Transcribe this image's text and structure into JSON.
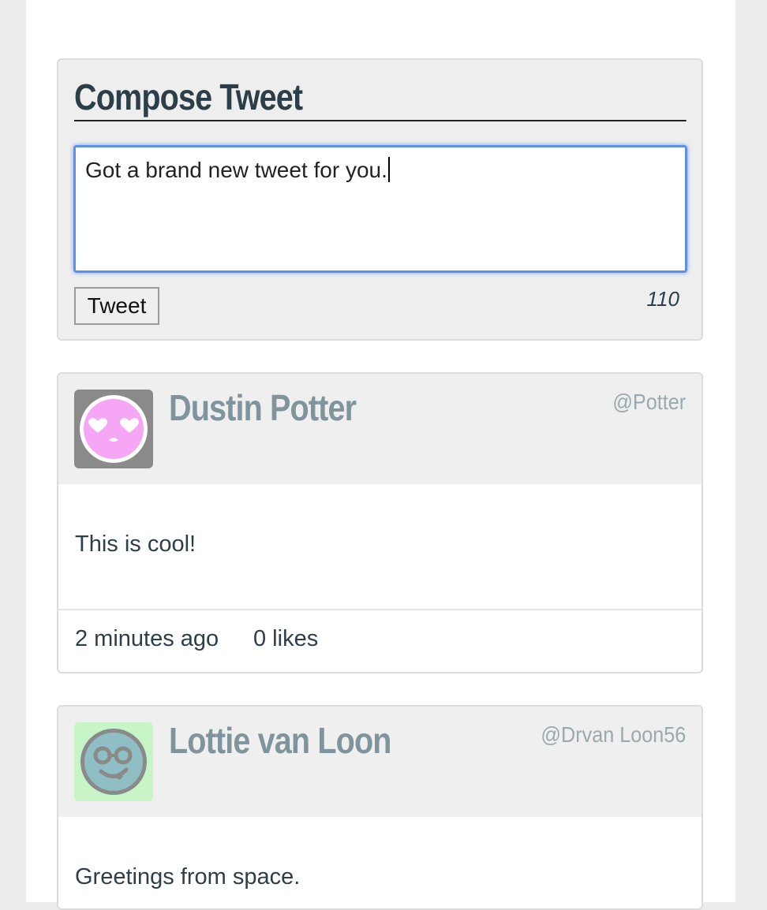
{
  "compose": {
    "title": "Compose Tweet",
    "textarea_value": "Got a brand new tweet for you.",
    "button_label": "Tweet",
    "counter": "110"
  },
  "tweets": [
    {
      "name": "Dustin Potter",
      "handle": "@Potter",
      "text": "This is cool!",
      "time": "2 minutes ago",
      "likes": "0 likes",
      "avatar": {
        "icon": "heart-eyes-face-icon",
        "bg": "#8a8a8a",
        "face": "#f5a6f5"
      }
    },
    {
      "name": "Lottie van Loon",
      "handle": "@Drvan Loon56",
      "text": "Greetings from space.",
      "time": "",
      "likes": "",
      "avatar": {
        "icon": "nerd-tongue-face-icon",
        "bg": "#c8f5c8",
        "face": "#8fbfc4"
      }
    }
  ]
}
